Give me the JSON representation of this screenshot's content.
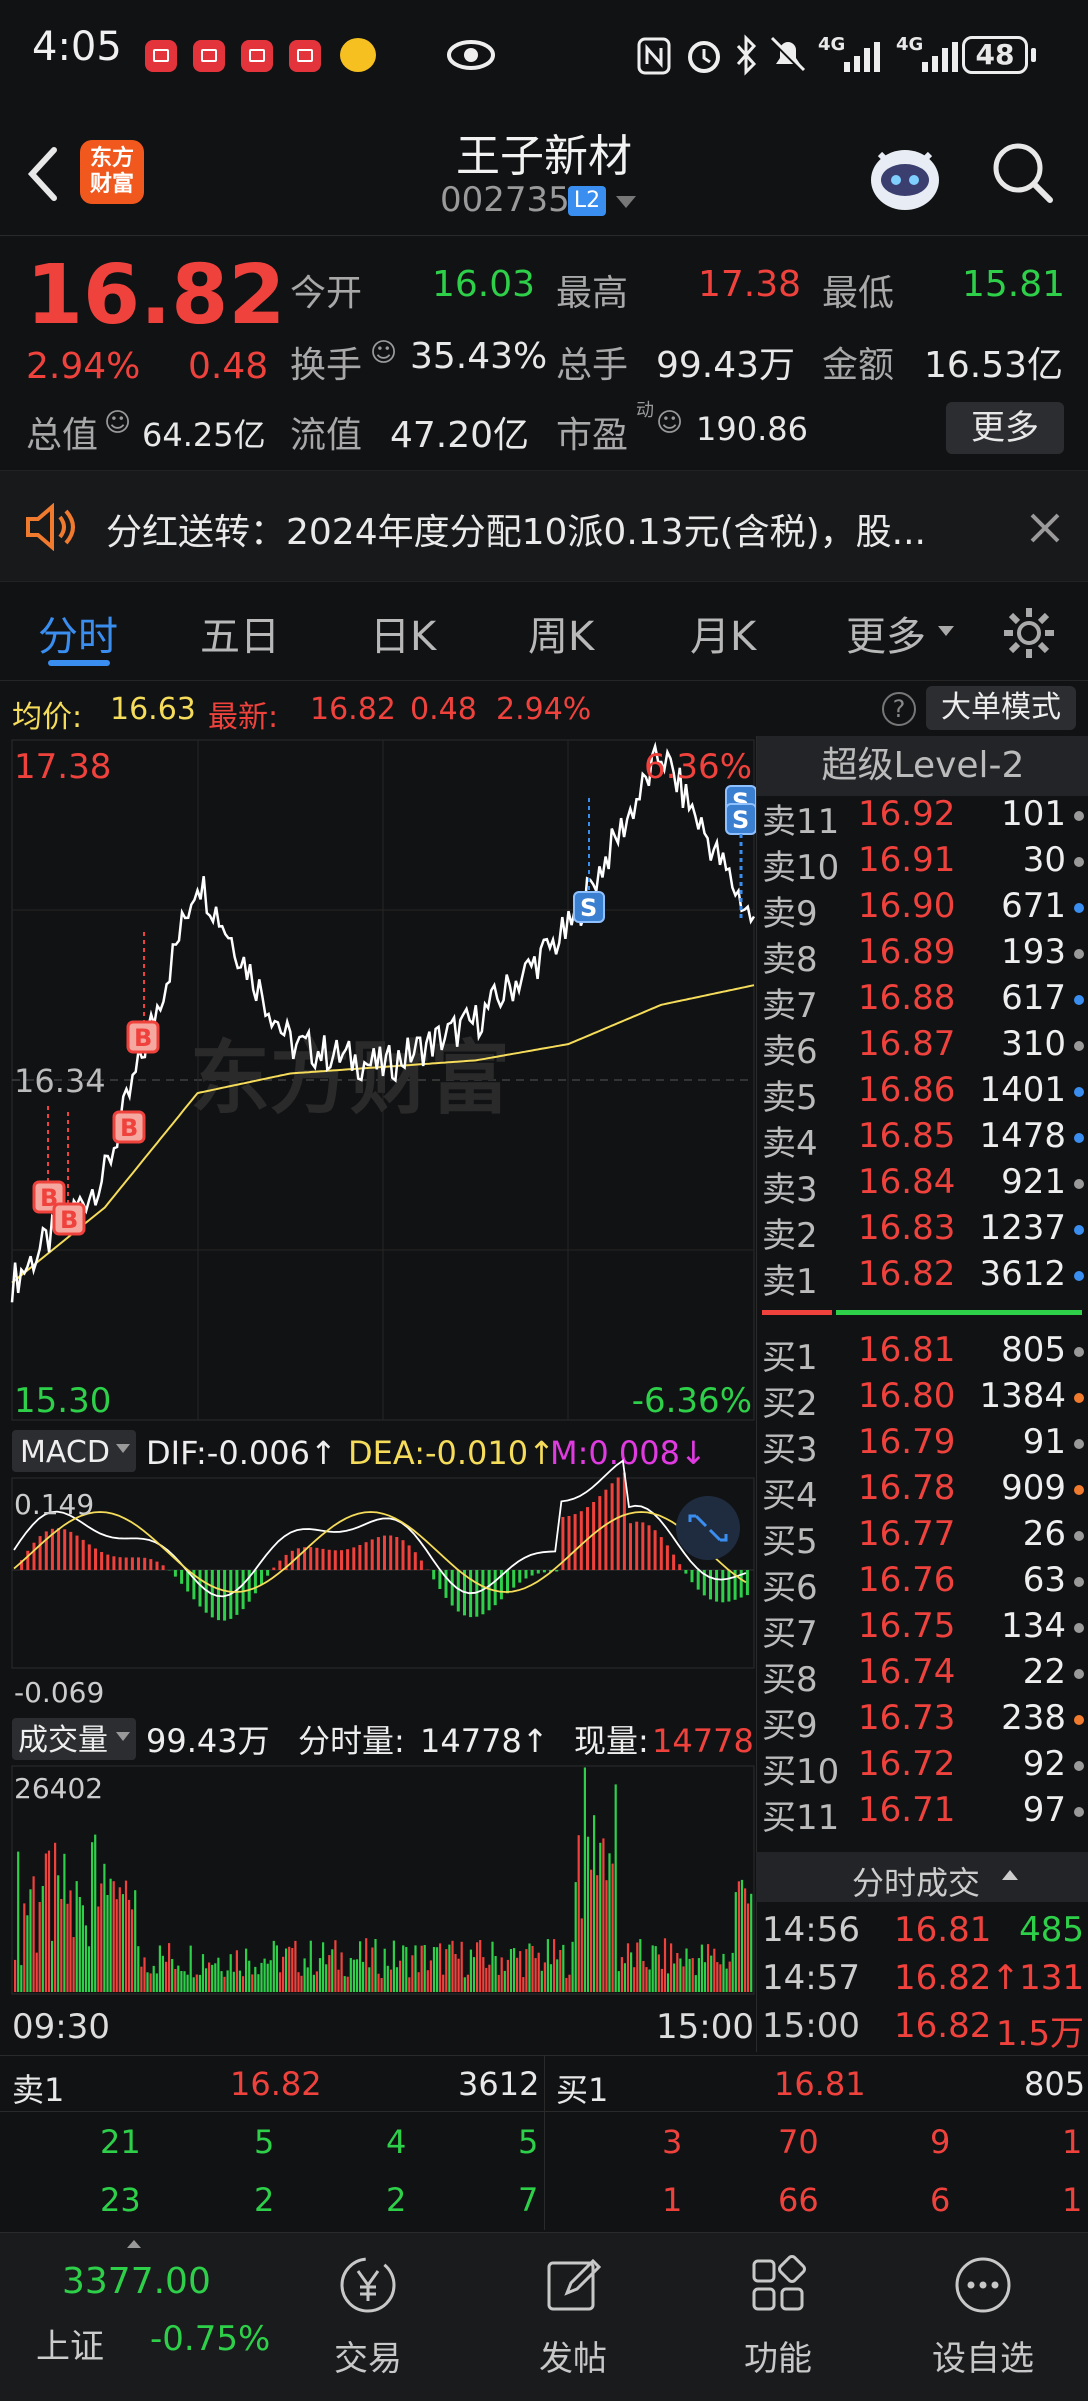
{
  "status": {
    "time": "4:05",
    "battery": "48",
    "net1": "4G",
    "net2": "4G"
  },
  "header": {
    "logo_line1": "东方",
    "logo_line2": "财富",
    "title": "王子新材",
    "code": "002735",
    "level_badge": "L2"
  },
  "quote": {
    "price": "16.82",
    "pct": "2.94%",
    "chg": "0.48",
    "open_label": "今开",
    "open": "16.03",
    "high_label": "最高",
    "high": "17.38",
    "low_label": "最低",
    "low": "15.81",
    "turnover_label": "换手",
    "turnover": "35.43%",
    "volume_label": "总手",
    "volume": "99.43万",
    "amount_label": "金额",
    "amount": "16.53亿",
    "mcap_label": "总值",
    "mcap": "64.25亿",
    "float_label": "流值",
    "float": "47.20亿",
    "pe_label": "市盈",
    "pe_sup": "动",
    "pe": "190.86",
    "more": "更多"
  },
  "notice": {
    "text": "分红送转：2024年度分配10派0.13元(含税)，股..."
  },
  "tabs": [
    {
      "label": "分时"
    },
    {
      "label": "五日"
    },
    {
      "label": "日K"
    },
    {
      "label": "周K"
    },
    {
      "label": "月K"
    },
    {
      "label": "更多"
    }
  ],
  "infobar": {
    "avg_label": "均价:",
    "avg": "16.63",
    "last_label": "最新:",
    "last": "16.82",
    "chg": "0.48",
    "pct": "2.94%",
    "bigorder": "大单模式"
  },
  "chart_labels": {
    "price_top": "17.38",
    "pct_top": "6.36%",
    "price_mid": "16.34",
    "price_bottom": "15.30",
    "pct_bottom": "-6.36%",
    "watermark": "东方财富",
    "macd_label": "MACD",
    "dif": "DIF:-0.006↑",
    "dea": "DEA:-0.010↑",
    "m": "M:0.008↓",
    "macd_top": "0.149",
    "macd_bottom": "-0.069",
    "vol_label": "成交量",
    "vol_total": "99.43万",
    "vol_min_label": "分时量:",
    "vol_min": "14778↑",
    "vol_now_label": "现量:",
    "vol_now": "14778",
    "vol_top": "26402",
    "time_start": "09:30",
    "time_end": "15:00"
  },
  "colors": {
    "up": "#f0423d",
    "down": "#2ed04a",
    "price_line": "#ffffff",
    "avg_line": "#f5dc5a",
    "accent": "#3a8ef0"
  },
  "chart_data": {
    "type": "line",
    "title": "",
    "ylim": [
      15.3,
      17.38
    ],
    "x": [
      "09:30",
      "10:00",
      "10:30",
      "11:00",
      "11:30",
      "13:30",
      "14:00",
      "14:30",
      "15:00"
    ],
    "series": [
      {
        "name": "",
        "values": [
          15.72,
          16.05,
          16.96,
          16.45,
          16.38,
          16.52,
          16.8,
          17.34,
          16.82
        ]
      },
      {
        "name": "均价",
        "values": [
          15.72,
          15.95,
          16.3,
          16.36,
          16.38,
          16.4,
          16.45,
          16.57,
          16.63
        ]
      }
    ]
  },
  "orderbook": {
    "header": "超级Level-2",
    "asks": [
      {
        "label": "卖11",
        "price": "16.92",
        "vol": "101",
        "dot": "#9a9a9a"
      },
      {
        "label": "卖10",
        "price": "16.91",
        "vol": "30",
        "dot": "#9a9a9a"
      },
      {
        "label": "卖9",
        "price": "16.90",
        "vol": "671",
        "dot": "#3a8ef0"
      },
      {
        "label": "卖8",
        "price": "16.89",
        "vol": "193",
        "dot": "#9a9a9a"
      },
      {
        "label": "卖7",
        "price": "16.88",
        "vol": "617",
        "dot": "#3a8ef0"
      },
      {
        "label": "卖6",
        "price": "16.87",
        "vol": "310",
        "dot": "#9a9a9a"
      },
      {
        "label": "卖5",
        "price": "16.86",
        "vol": "1401",
        "dot": "#3a8ef0"
      },
      {
        "label": "卖4",
        "price": "16.85",
        "vol": "1478",
        "dot": "#3a8ef0"
      },
      {
        "label": "卖3",
        "price": "16.84",
        "vol": "921",
        "dot": "#9a9a9a"
      },
      {
        "label": "卖2",
        "price": "16.83",
        "vol": "1237",
        "dot": "#3a8ef0"
      },
      {
        "label": "卖1",
        "price": "16.82",
        "vol": "3612",
        "dot": "#3a8ef0"
      }
    ],
    "bids": [
      {
        "label": "买1",
        "price": "16.81",
        "vol": "805",
        "dot": "#9a9a9a"
      },
      {
        "label": "买2",
        "price": "16.80",
        "vol": "1384",
        "dot": "#f07a2e"
      },
      {
        "label": "买3",
        "price": "16.79",
        "vol": "91",
        "dot": "#9a9a9a"
      },
      {
        "label": "买4",
        "price": "16.78",
        "vol": "909",
        "dot": "#f07a2e"
      },
      {
        "label": "买5",
        "price": "16.77",
        "vol": "26",
        "dot": "#9a9a9a"
      },
      {
        "label": "买6",
        "price": "16.76",
        "vol": "63",
        "dot": "#9a9a9a"
      },
      {
        "label": "买7",
        "price": "16.75",
        "vol": "134",
        "dot": "#9a9a9a"
      },
      {
        "label": "买8",
        "price": "16.74",
        "vol": "22",
        "dot": "#9a9a9a"
      },
      {
        "label": "买9",
        "price": "16.73",
        "vol": "238",
        "dot": "#f07a2e"
      },
      {
        "label": "买10",
        "price": "16.72",
        "vol": "92",
        "dot": "#9a9a9a"
      },
      {
        "label": "买11",
        "price": "16.71",
        "vol": "97",
        "dot": "#9a9a9a"
      }
    ],
    "trades_header": "分时成交",
    "trades": [
      {
        "time": "14:56",
        "price": "16.81",
        "vol": "485",
        "vcolor": "#2ed04a"
      },
      {
        "time": "14:57",
        "price": "16.82↑",
        "vol": "131",
        "vcolor": "#f0423d"
      },
      {
        "time": "15:00",
        "price": "16.82",
        "vol": "1.5万",
        "vcolor": "#f0423d"
      }
    ]
  },
  "bottom": {
    "ask_label": "卖1",
    "ask_price": "16.82",
    "ask_vol": "3612",
    "bid_label": "买1",
    "bid_price": "16.81",
    "bid_vol": "805",
    "ask_row1": [
      "21",
      "5",
      "4",
      "5"
    ],
    "ask_row2": [
      "23",
      "2",
      "2",
      "7"
    ],
    "bid_row1": [
      "3",
      "70",
      "9",
      "1"
    ],
    "bid_row2": [
      "1",
      "66",
      "6",
      "1"
    ]
  },
  "nav": {
    "index_value": "3377.00",
    "index_name": "上证",
    "index_pct": "-0.75%",
    "items": [
      {
        "label": "交易",
        "icon": "yen-circle-icon"
      },
      {
        "label": "发帖",
        "icon": "edit-icon"
      },
      {
        "label": "功能",
        "icon": "grid-icon"
      },
      {
        "label": "设自选",
        "icon": "more-circle-icon"
      }
    ]
  }
}
